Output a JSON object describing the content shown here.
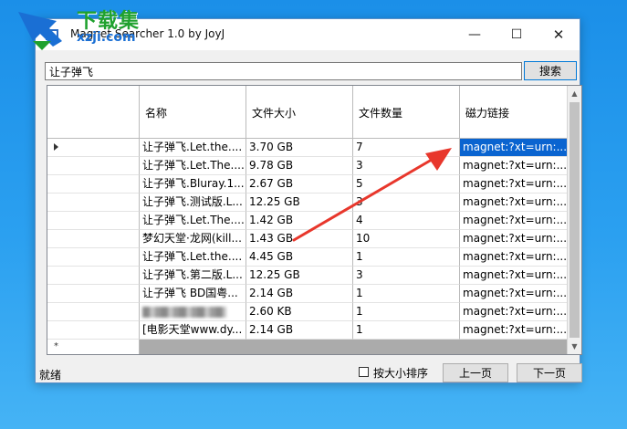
{
  "window": {
    "title": "Magnet Searcher 1.0 by JoyJ",
    "controls": {
      "minimize": "—",
      "maximize": "☐",
      "close": "✕"
    }
  },
  "watermark": {
    "main": "下载集",
    "sub": "xzji.com"
  },
  "search": {
    "value": "让子弹飞",
    "button_label": "搜索"
  },
  "table": {
    "columns": [
      "名称",
      "文件大小",
      "文件数量",
      "磁力链接"
    ],
    "rows": [
      {
        "name": "让子弹飞.Let.the....",
        "size": "3.70 GB",
        "count": "7",
        "link": "magnet:?xt=urn:...",
        "selected": true,
        "current": true
      },
      {
        "name": "让子弹飞.Let.The....",
        "size": "9.78 GB",
        "count": "3",
        "link": "magnet:?xt=urn:..."
      },
      {
        "name": "让子弹飞.Bluray.1...",
        "size": "2.67 GB",
        "count": "5",
        "link": "magnet:?xt=urn:..."
      },
      {
        "name": "让子弹飞.测试版.L...",
        "size": "12.25 GB",
        "count": "3",
        "link": "magnet:?xt=urn:..."
      },
      {
        "name": "让子弹飞.Let.The....",
        "size": "1.42 GB",
        "count": "4",
        "link": "magnet:?xt=urn:..."
      },
      {
        "name": "梦幻天堂·龙网(kill...",
        "size": "1.43 GB",
        "count": "10",
        "link": "magnet:?xt=urn:..."
      },
      {
        "name": "让子弹飞.Let.the....",
        "size": "4.45 GB",
        "count": "1",
        "link": "magnet:?xt=urn:..."
      },
      {
        "name": "让子弹飞.第二版.L...",
        "size": "12.25 GB",
        "count": "3",
        "link": "magnet:?xt=urn:..."
      },
      {
        "name": "让子弹飞 BD国粤...",
        "size": "2.14 GB",
        "count": "1",
        "link": "magnet:?xt=urn:..."
      },
      {
        "name": "",
        "blurred": true,
        "size": "2.60 KB",
        "count": "1",
        "link": "magnet:?xt=urn:..."
      },
      {
        "name": "[电影天堂www.dy...",
        "size": "2.14 GB",
        "count": "1",
        "link": "magnet:?xt=urn:..."
      }
    ],
    "new_row_marker": "*"
  },
  "status": {
    "text": "就绪"
  },
  "sort": {
    "label": "按大小排序",
    "checked": false
  },
  "pager": {
    "prev_label": "上一页",
    "next_label": "下一页"
  },
  "colors": {
    "selection": "#0a64d0",
    "annotation_arrow": "#e8372c",
    "watermark_green": "#1fa12e",
    "watermark_blue": "#1a6fd4"
  }
}
